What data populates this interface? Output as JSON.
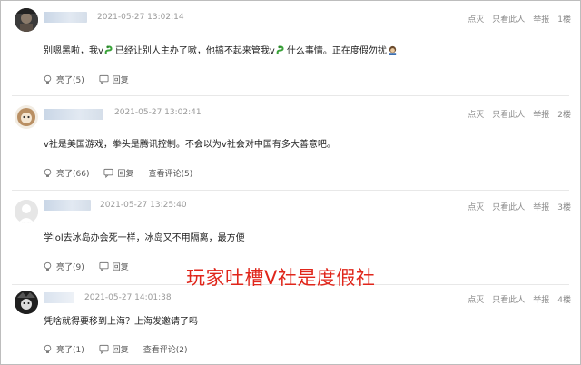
{
  "comments": [
    {
      "time": "2021-05-27 13:02:14",
      "tools": [
        "点灭",
        "只看此人",
        "举报",
        "1楼"
      ],
      "text_parts": [
        "别嗯黑啦，我v",
        "已经让别人主办了嗽，他搞不起来管我v",
        "什么事情。正在度假勿扰"
      ],
      "like_label": "亮了(5)",
      "reply_label": "回复",
      "view_label": ""
    },
    {
      "time": "2021-05-27 13:02:41",
      "tools": [
        "点灭",
        "只看此人",
        "举报",
        "2楼"
      ],
      "text": "v社是美国游戏，拳头是腾讯控制。不会以为v社会对中国有多大善意吧。",
      "like_label": "亮了(66)",
      "reply_label": "回复",
      "view_label": "查看评论(5)"
    },
    {
      "time": "2021-05-27 13:25:40",
      "tools": [
        "点灭",
        "只看此人",
        "举报",
        "3楼"
      ],
      "text": "学lol去冰岛办会死一样，冰岛又不用隔离，最方便",
      "like_label": "亮了(9)",
      "reply_label": "回复",
      "view_label": ""
    },
    {
      "time": "2021-05-27 14:01:38",
      "tools": [
        "点灭",
        "只看此人",
        "举报",
        "4楼"
      ],
      "text": "凭啥就得要移到上海？上海发邀请了吗",
      "like_label": "亮了(1)",
      "reply_label": "回复",
      "view_label": "查看评论(2)"
    }
  ],
  "overlay_caption": "玩家吐槽V社是度假社",
  "colors": {
    "overlay": "#e0261b",
    "meta": "#9a9a9a",
    "text": "#222222"
  }
}
